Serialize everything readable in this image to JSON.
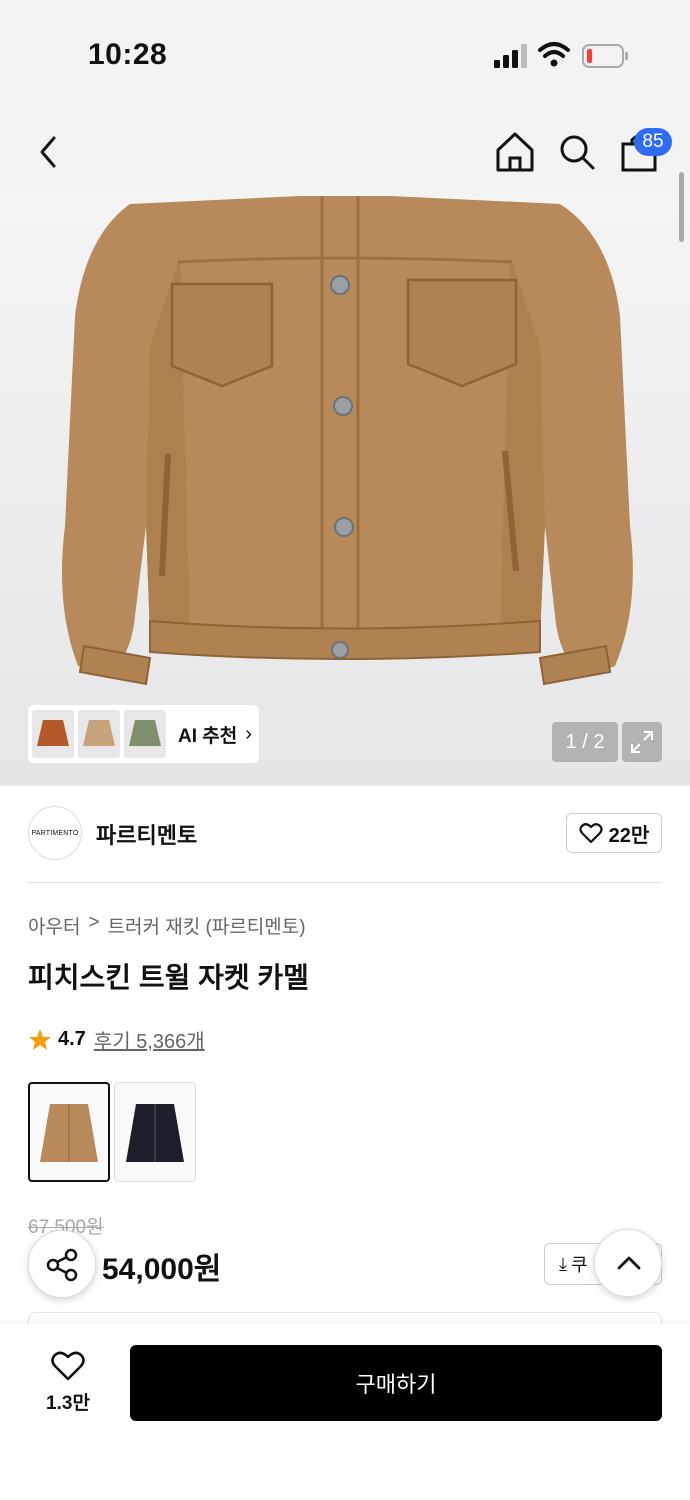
{
  "status_bar": {
    "time": "10:28"
  },
  "nav": {
    "cart_count": "85"
  },
  "gallery": {
    "ai_label": "AI 추천",
    "counter": "1 / 2",
    "colors": {
      "jacket": "#b8895a",
      "background": "#efeff0"
    }
  },
  "brand": {
    "logo_text": "PARTIMENTO",
    "name": "파르티멘토",
    "likes": "22만"
  },
  "breadcrumb": {
    "category": "아우터",
    "separator": ">",
    "subcategory": "트러커 재킷 (파르티멘토)"
  },
  "product": {
    "title": "피치스킨 트윌 자켓 카멜",
    "rating": "4.7",
    "reviews": "후기 5,366개",
    "original_price": "67,500원",
    "price": "54,000원",
    "coupon_label": "쿠"
  },
  "bottom": {
    "wish_count": "1.3만",
    "buy_label": "구매하기"
  }
}
